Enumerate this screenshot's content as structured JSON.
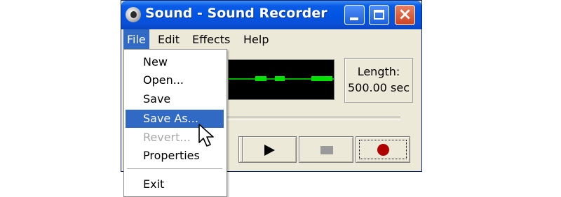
{
  "window": {
    "title": "Sound - Sound Recorder",
    "buttons": {
      "minimize": "minimize-icon",
      "maximize": "maximize-icon",
      "close": "close-icon"
    }
  },
  "menubar": {
    "items": [
      {
        "label": "File"
      },
      {
        "label": "Edit"
      },
      {
        "label": "Effects"
      },
      {
        "label": "Help"
      }
    ],
    "active": "File"
  },
  "file_menu": {
    "items": [
      {
        "label": "New",
        "state": "normal"
      },
      {
        "label": "Open...",
        "state": "normal"
      },
      {
        "label": "Save",
        "state": "normal"
      },
      {
        "label": "Save As...",
        "state": "highlighted"
      },
      {
        "label": "Revert...",
        "state": "disabled"
      },
      {
        "label": "Properties",
        "state": "normal"
      },
      {
        "label": "Exit",
        "state": "normal"
      }
    ]
  },
  "length": {
    "label": "Length:",
    "value": "500.00 sec"
  },
  "controls": {
    "play": "play-icon",
    "stop": "stop-icon",
    "record": "record-icon"
  },
  "colors": {
    "titlebar": "#0054e3",
    "menu_highlight": "#316ac5",
    "waveform": "#00e000",
    "record": "#b00000"
  }
}
